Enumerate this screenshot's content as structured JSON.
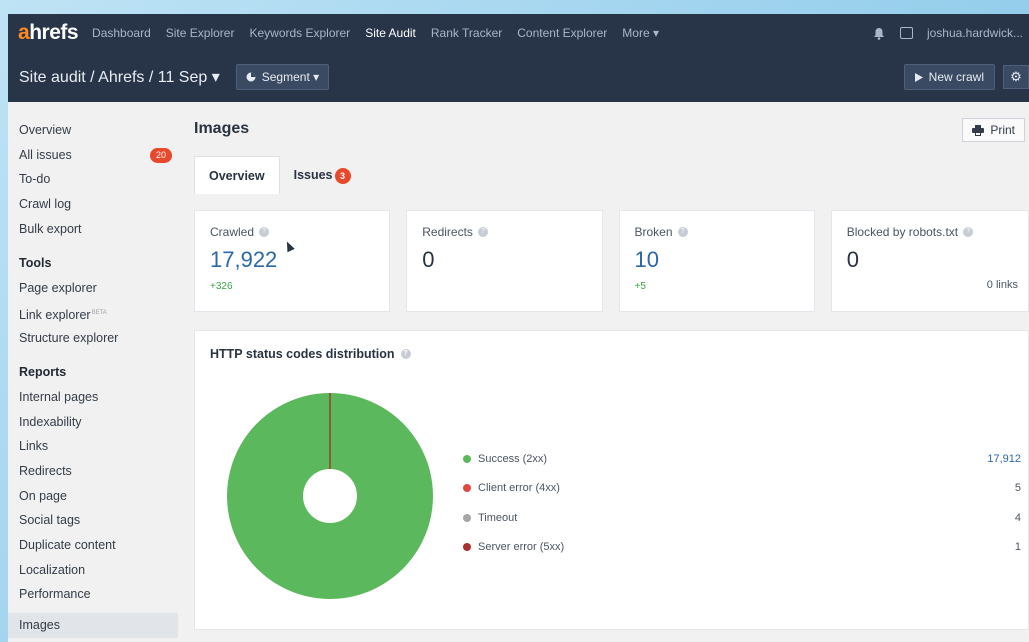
{
  "brand": {
    "logo_prefix": "a",
    "logo_rest": "hrefs"
  },
  "topnav": {
    "items": [
      {
        "label": "Dashboard"
      },
      {
        "label": "Site Explorer"
      },
      {
        "label": "Keywords Explorer"
      },
      {
        "label": "Site Audit",
        "active": true
      },
      {
        "label": "Rank Tracker"
      },
      {
        "label": "Content Explorer"
      },
      {
        "label": "More ▾"
      }
    ],
    "user": "joshua.hardwick..."
  },
  "subheader": {
    "breadcrumb": "Site audit / Ahrefs / 11 Sep ▾",
    "segment_label": "Segment ▾",
    "new_crawl_label": "New crawl"
  },
  "sidebar": {
    "group1": [
      {
        "label": "Overview"
      },
      {
        "label": "All issues",
        "badge": "20"
      },
      {
        "label": "To-do"
      },
      {
        "label": "Crawl log"
      },
      {
        "label": "Bulk export"
      }
    ],
    "tools_heading": "Tools",
    "tools": [
      {
        "label": "Page explorer"
      },
      {
        "label": "Link explorer",
        "tag": "BETA"
      },
      {
        "label": "Structure explorer"
      }
    ],
    "reports_heading": "Reports",
    "reports": [
      {
        "label": "Internal pages"
      },
      {
        "label": "Indexability"
      },
      {
        "label": "Links"
      },
      {
        "label": "Redirects"
      },
      {
        "label": "On page"
      },
      {
        "label": "Social tags"
      },
      {
        "label": "Duplicate content"
      },
      {
        "label": "Localization"
      },
      {
        "label": "Performance"
      },
      {
        "label": "Images",
        "selected": true
      }
    ]
  },
  "main": {
    "title": "Images",
    "print_label": "Print",
    "tabs": [
      {
        "label": "Overview",
        "active": true
      },
      {
        "label": "Issues",
        "badge": "3"
      }
    ],
    "cards": [
      {
        "label": "Crawled",
        "value": "17,922",
        "delta": "+326"
      },
      {
        "label": "Redirects",
        "value": "0"
      },
      {
        "label": "Broken",
        "value": "10",
        "delta": "+5"
      },
      {
        "label": "Blocked by robots.txt",
        "value": "0",
        "links": "0 links"
      }
    ],
    "chart_title": "HTTP status codes distribution"
  },
  "colors": {
    "success": "#5cb85c",
    "client_error": "#e0483e",
    "timeout": "#a6a6a6",
    "server_error": "#a8322f",
    "accent": "#ff8a1f",
    "nav_bg": "#283447"
  },
  "chart_data": {
    "type": "pie",
    "donut": true,
    "title": "HTTP status codes distribution",
    "categories": [
      "Success (2xx)",
      "Client error (4xx)",
      "Timeout",
      "Server error (5xx)"
    ],
    "values": [
      17912,
      5,
      4,
      1
    ],
    "display_values": [
      "17,912",
      "5",
      "4",
      "1"
    ],
    "colors": [
      "#5cb85c",
      "#e0483e",
      "#a6a6a6",
      "#a8322f"
    ],
    "legend": "right"
  }
}
